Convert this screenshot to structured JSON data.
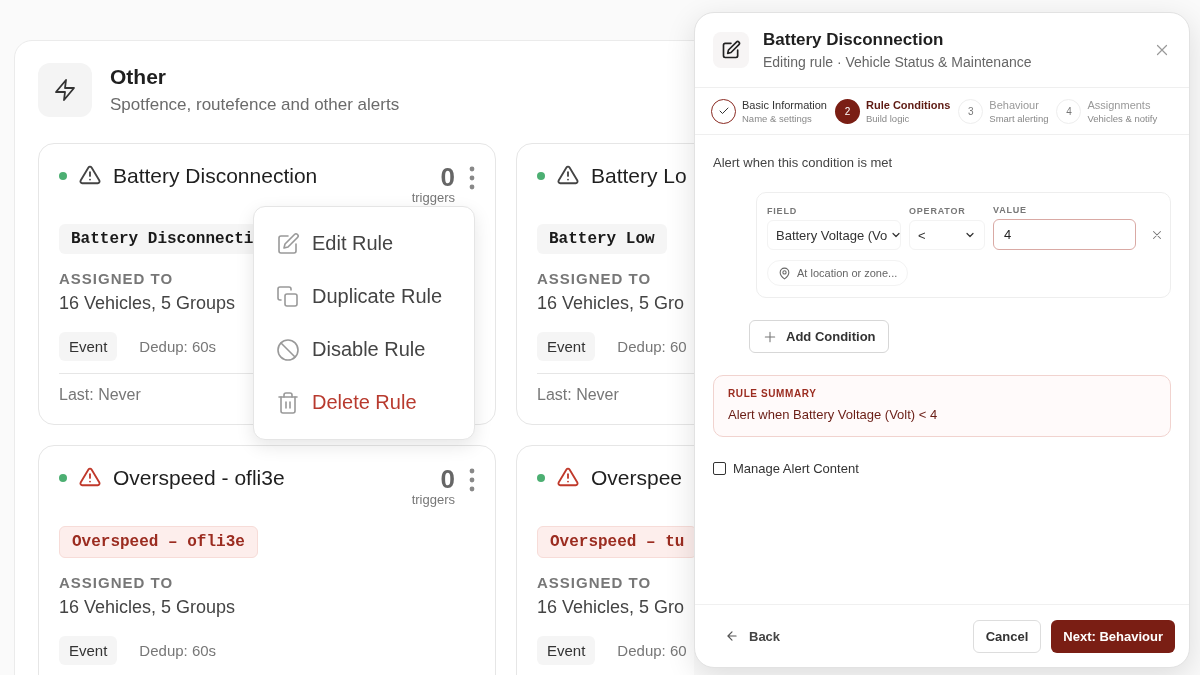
{
  "section": {
    "title": "Other",
    "subtitle": "Spotfence, routefence and other alerts"
  },
  "rules": [
    {
      "title": "Battery Disconnection",
      "active": true,
      "kind": "warning",
      "triggers": "0",
      "triggers_label": "triggers",
      "code": "Battery Disconnecti",
      "assigned_label": "ASSIGNED TO",
      "assigned": "16 Vehicles, 5 Groups",
      "type": "Event",
      "dedup": "Dedup: 60s",
      "last": "Last: Never"
    },
    {
      "title": "Battery Lo",
      "active": true,
      "kind": "warning",
      "code": "Battery Low",
      "assigned_label": "ASSIGNED TO",
      "assigned": "16 Vehicles, 5 Gro",
      "type": "Event",
      "dedup": "Dedup: 60",
      "last": "Last: Never"
    },
    {
      "title": "Overspeed - ofli3e",
      "active": true,
      "kind": "critical",
      "triggers": "0",
      "triggers_label": "triggers",
      "code": "Overspeed – ofli3e",
      "assigned_label": "ASSIGNED TO",
      "assigned": "16 Vehicles, 5 Groups",
      "type": "Event",
      "dedup": "Dedup: 60s"
    },
    {
      "title": "Overspee",
      "active": true,
      "kind": "critical",
      "code": "Overspeed – tu",
      "assigned_label": "ASSIGNED TO",
      "assigned": "16 Vehicles, 5 Gro",
      "type": "Event",
      "dedup": "Dedup: 60"
    }
  ],
  "menu": {
    "items": [
      {
        "label": "Edit Rule",
        "kind": "edit"
      },
      {
        "label": "Duplicate Rule",
        "kind": "duplicate"
      },
      {
        "label": "Disable Rule",
        "kind": "disable"
      },
      {
        "label": "Delete Rule",
        "kind": "delete"
      }
    ]
  },
  "dialog": {
    "title": "Battery Disconnection",
    "subtitle": "Editing rule · Vehicle Status & Maintenance",
    "steps": [
      {
        "title": "Basic Information",
        "subtitle": "Name & settings",
        "completed": true,
        "selected": false
      },
      {
        "number": "2",
        "title": "Rule Conditions",
        "subtitle": "Build logic",
        "completed": false,
        "selected": true
      },
      {
        "number": "3",
        "title": "Behaviour",
        "subtitle": "Smart alerting",
        "completed": false,
        "selected": false
      },
      {
        "number": "4",
        "title": "Assignments",
        "subtitle": "Vehicles & notify",
        "completed": false,
        "selected": false
      }
    ],
    "intro": "Alert when this condition is met",
    "condition": {
      "field_label": "FIELD",
      "field": "Battery Voltage (Vo",
      "operator_label": "OPERATOR",
      "operator": "<",
      "value_label": "VALUE",
      "value": "4",
      "location_button": "At location or zone..."
    },
    "add_button": "Add Condition",
    "summary": {
      "label": "RULE SUMMARY",
      "text": "Alert when Battery Voltage (Volt) < 4"
    },
    "manage_content": {
      "label": "Manage Alert Content",
      "checked": false
    },
    "back_button": "Back",
    "cancel_button": "Cancel",
    "next_button": "Next: Behaviour"
  }
}
